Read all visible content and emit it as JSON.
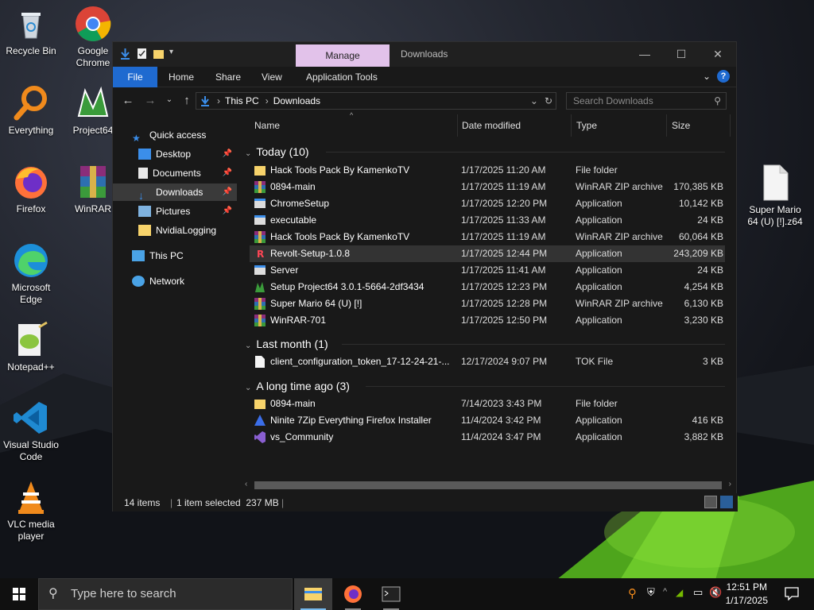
{
  "desktop": {
    "icons": [
      {
        "name": "recycle-bin",
        "label": "Recycle Bin"
      },
      {
        "name": "google-chrome",
        "label": "Google Chrome"
      },
      {
        "name": "everything",
        "label": "Everything"
      },
      {
        "name": "project64",
        "label": "Project64"
      },
      {
        "name": "firefox",
        "label": "Firefox"
      },
      {
        "name": "winrar",
        "label": "WinRAR"
      },
      {
        "name": "microsoft-edge",
        "label": "Microsoft Edge"
      },
      {
        "name": "notepad-plus-plus",
        "label": "Notepad++"
      },
      {
        "name": "visual-studio-code",
        "label": "Visual Studio Code"
      },
      {
        "name": "vlc-media-player",
        "label": "VLC media player"
      },
      {
        "name": "super-mario-file",
        "label": "Super Mario 64 (U) [!].z64"
      }
    ]
  },
  "explorer": {
    "title": "Downloads",
    "manage_tab": "Manage",
    "ribbon_tabs": [
      "File",
      "Home",
      "Share",
      "View",
      "Application Tools"
    ],
    "address": {
      "crumbs": [
        "This PC",
        "Downloads"
      ]
    },
    "search_placeholder": "Search Downloads",
    "nav": {
      "quick_access": "Quick access",
      "items": [
        "Desktop",
        "Documents",
        "Downloads",
        "Pictures",
        "NvidiaLogging"
      ],
      "this_pc": "This PC",
      "network": "Network"
    },
    "columns": [
      "Name",
      "Date modified",
      "Type",
      "Size"
    ],
    "groups": [
      {
        "title": "Today (10)",
        "rows": [
          {
            "name": "Hack Tools Pack By KamenkoTV",
            "date": "1/17/2025 11:20 AM",
            "type": "File folder",
            "size": "",
            "icon": "folder-icon"
          },
          {
            "name": "0894-main",
            "date": "1/17/2025 11:19 AM",
            "type": "WinRAR ZIP archive",
            "size": "170,385 KB",
            "icon": "winrar-icon"
          },
          {
            "name": "ChromeSetup",
            "date": "1/17/2025 12:20 PM",
            "type": "Application",
            "size": "10,142 KB",
            "icon": "app-icon"
          },
          {
            "name": "executable",
            "date": "1/17/2025 11:33 AM",
            "type": "Application",
            "size": "24 KB",
            "icon": "app-icon"
          },
          {
            "name": "Hack Tools Pack By KamenkoTV",
            "date": "1/17/2025 11:19 AM",
            "type": "WinRAR ZIP archive",
            "size": "60,064 KB",
            "icon": "winrar-icon"
          },
          {
            "name": "Revolt-Setup-1.0.8",
            "date": "1/17/2025 12:44 PM",
            "type": "Application",
            "size": "243,209 KB",
            "icon": "revolt-icon",
            "selected": true
          },
          {
            "name": "Server",
            "date": "1/17/2025 11:41 AM",
            "type": "Application",
            "size": "24 KB",
            "icon": "app-icon"
          },
          {
            "name": "Setup Project64 3.0.1-5664-2df3434",
            "date": "1/17/2025 12:23 PM",
            "type": "Application",
            "size": "4,254 KB",
            "icon": "project64-icon"
          },
          {
            "name": "Super Mario 64 (U) [!]",
            "date": "1/17/2025 12:28 PM",
            "type": "WinRAR ZIP archive",
            "size": "6,130 KB",
            "icon": "winrar-icon"
          },
          {
            "name": "WinRAR-701",
            "date": "1/17/2025 12:50 PM",
            "type": "Application",
            "size": "3,230 KB",
            "icon": "winrar-icon"
          }
        ]
      },
      {
        "title": "Last month (1)",
        "rows": [
          {
            "name": "client_configuration_token_17-12-24-21-...",
            "date": "12/17/2024 9:07 PM",
            "type": "TOK File",
            "size": "3 KB",
            "icon": "file-icon"
          }
        ]
      },
      {
        "title": "A long time ago (3)",
        "rows": [
          {
            "name": "0894-main",
            "date": "7/14/2023 3:43 PM",
            "type": "File folder",
            "size": "",
            "icon": "folder-icon"
          },
          {
            "name": "Ninite 7Zip Everything Firefox Installer",
            "date": "11/4/2024 3:42 PM",
            "type": "Application",
            "size": "416 KB",
            "icon": "ninite-icon"
          },
          {
            "name": "vs_Community",
            "date": "11/4/2024 3:47 PM",
            "type": "Application",
            "size": "3,882 KB",
            "icon": "vs-icon"
          }
        ]
      }
    ],
    "status": {
      "items": "14 items",
      "selected": "1 item selected  237 MB"
    }
  },
  "taskbar": {
    "search_placeholder": "Type here to search",
    "clock_time": "12:51 PM",
    "clock_date": "1/17/2025"
  }
}
